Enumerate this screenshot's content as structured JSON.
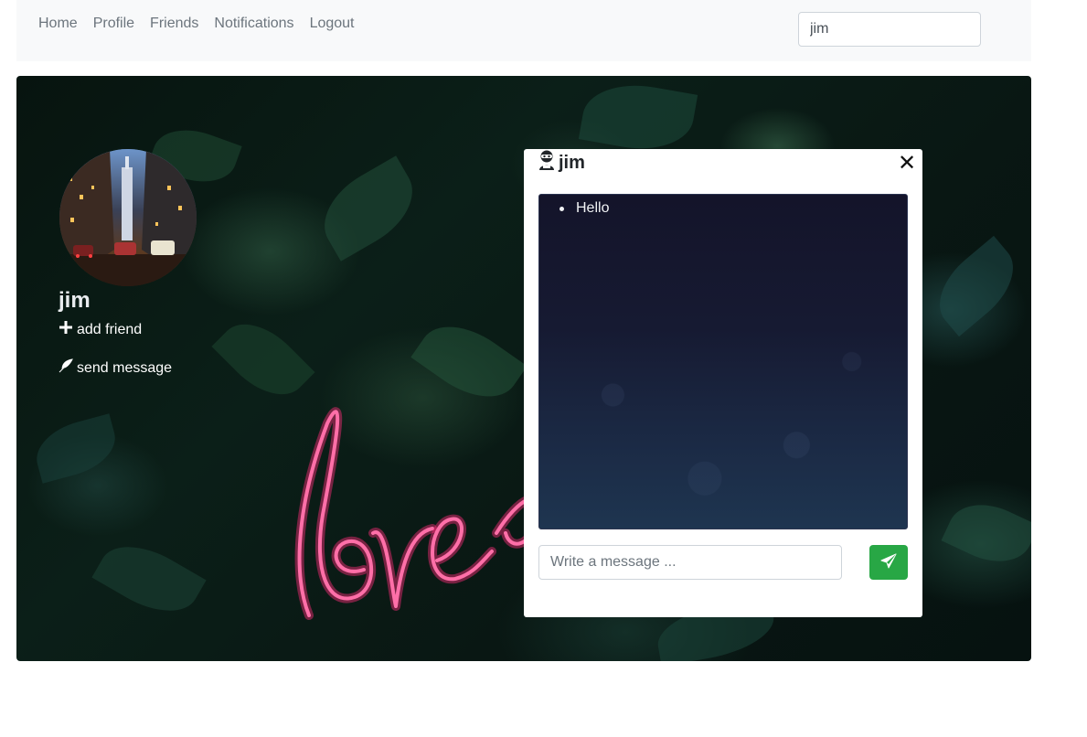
{
  "nav": {
    "links": [
      "Home",
      "Profile",
      "Friends",
      "Notifications",
      "Logout"
    ],
    "search_value": "jim"
  },
  "profile": {
    "name": "jim",
    "add_friend_label": "add friend",
    "send_message_label": "send message"
  },
  "chat": {
    "title": "jim",
    "close_glyph": "✕",
    "messages": [
      "Hello"
    ],
    "input_placeholder": "Write a message ..."
  },
  "colors": {
    "send_button": "#28a745",
    "nav_background": "#f8f9fa",
    "nav_link": "#6c757d"
  }
}
